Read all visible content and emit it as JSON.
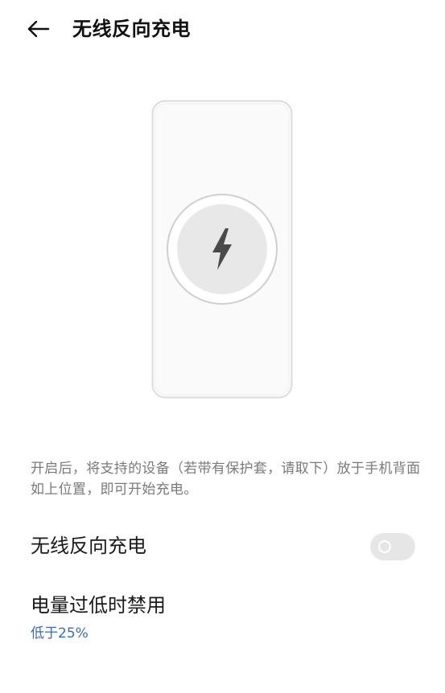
{
  "header": {
    "back_icon": "arrow-left-icon",
    "title": "无线反向充电"
  },
  "illustration": {
    "device_icon": "phone-icon",
    "charge_icon": "lightning-bolt-icon"
  },
  "description": "开启后，将支持的设备（若带有保护套，请取下）放于手机背面如上位置，即可开始充电。",
  "settings": {
    "reverse_charging": {
      "label": "无线反向充电",
      "enabled": false
    },
    "low_battery_disable": {
      "label": "电量过低时禁用",
      "value": "低于25%"
    }
  },
  "colors": {
    "accent": "#2f6ccf",
    "secondary_text": "#7a7a7a",
    "toggle_off": "#e6e6e6"
  }
}
